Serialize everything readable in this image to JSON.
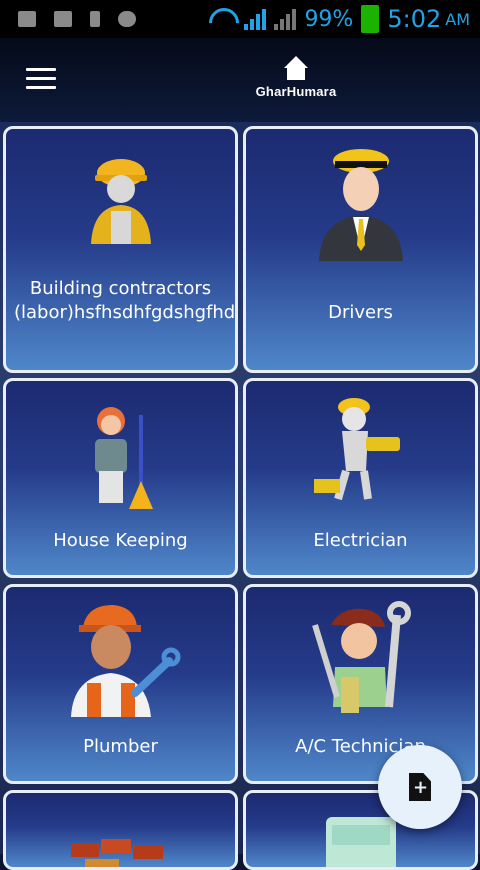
{
  "status_bar": {
    "battery_percent": "99%",
    "time": "5:02",
    "ampm": "AM"
  },
  "app_bar": {
    "logo_text": "GharHumara"
  },
  "services": [
    {
      "label": "Building contractors (labor)hsfhsdhfgdshgfhdsghsgg"
    },
    {
      "label": "Drivers"
    },
    {
      "label": "House Keeping"
    },
    {
      "label": "Electrician"
    },
    {
      "label": "Plumber"
    },
    {
      "label": "A/C Technician"
    }
  ]
}
